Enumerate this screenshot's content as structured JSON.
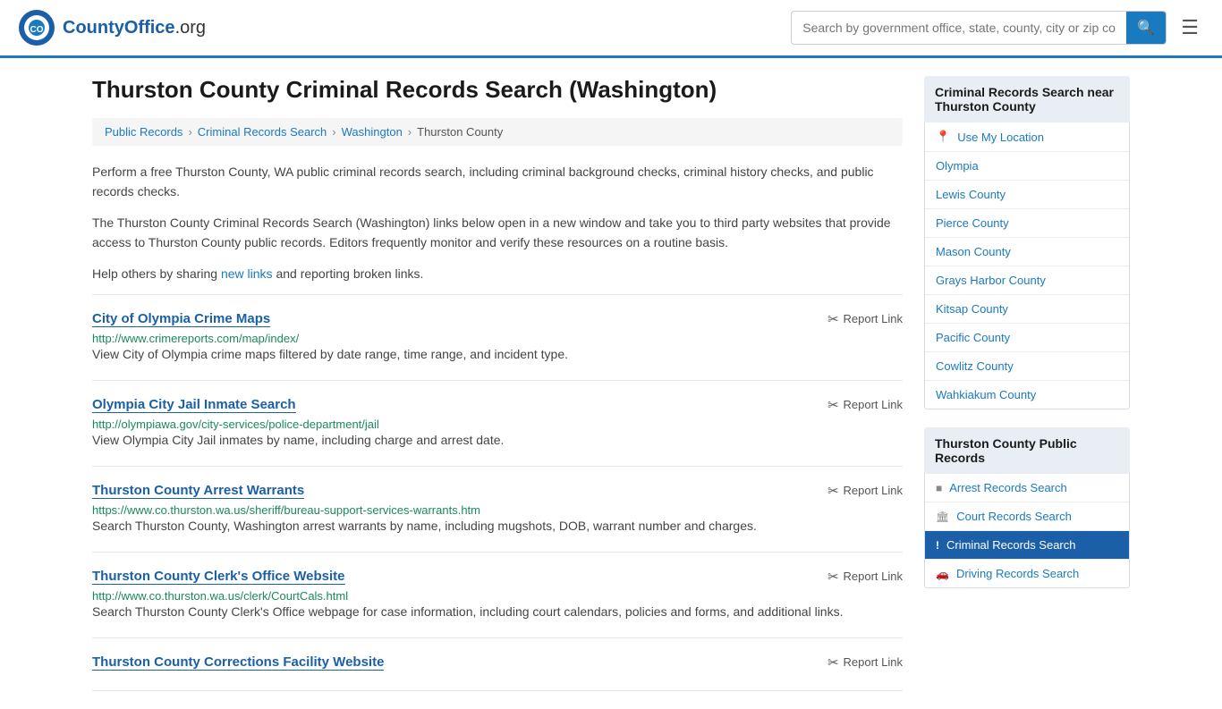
{
  "header": {
    "logo_text": "CountyOffice",
    "logo_suffix": ".org",
    "search_placeholder": "Search by government office, state, county, city or zip code"
  },
  "page": {
    "title": "Thurston County Criminal Records Search (Washington)",
    "breadcrumbs": [
      {
        "label": "Public Records",
        "href": "#"
      },
      {
        "label": "Criminal Records Search",
        "href": "#"
      },
      {
        "label": "Washington",
        "href": "#"
      },
      {
        "label": "Thurston County",
        "href": "#"
      }
    ],
    "intro1": "Perform a free Thurston County, WA public criminal records search, including criminal background checks, criminal history checks, and public records checks.",
    "intro2": "The Thurston County Criminal Records Search (Washington) links below open in a new window and take you to third party websites that provide access to Thurston County public records. Editors frequently monitor and verify these resources on a routine basis.",
    "intro3_prefix": "Help others by sharing ",
    "intro3_link": "new links",
    "intro3_suffix": " and reporting broken links."
  },
  "results": [
    {
      "title": "City of Olympia Crime Maps",
      "url": "http://www.crimereports.com/map/index/",
      "desc": "View City of Olympia crime maps filtered by date range, time range, and incident type.",
      "report": "Report Link"
    },
    {
      "title": "Olympia City Jail Inmate Search",
      "url": "http://olympiawa.gov/city-services/police-department/jail",
      "desc": "View Olympia City Jail inmates by name, including charge and arrest date.",
      "report": "Report Link"
    },
    {
      "title": "Thurston County Arrest Warrants",
      "url": "https://www.co.thurston.wa.us/sheriff/bureau-support-services-warrants.htm",
      "desc": "Search Thurston County, Washington arrest warrants by name, including mugshots, DOB, warrant number and charges.",
      "report": "Report Link"
    },
    {
      "title": "Thurston County Clerk's Office Website",
      "url": "http://www.co.thurston.wa.us/clerk/CourtCals.html",
      "desc": "Search Thurston County Clerk's Office webpage for case information, including court calendars, policies and forms, and additional links.",
      "report": "Report Link"
    },
    {
      "title": "Thurston County Corrections Facility Website",
      "url": "",
      "desc": "",
      "report": "Report Link"
    }
  ],
  "sidebar": {
    "nearby_header": "Criminal Records Search near Thurston County",
    "use_my_location": "Use My Location",
    "nearby_links": [
      {
        "label": "Olympia"
      },
      {
        "label": "Lewis County"
      },
      {
        "label": "Pierce County"
      },
      {
        "label": "Mason County"
      },
      {
        "label": "Grays Harbor County"
      },
      {
        "label": "Kitsap County"
      },
      {
        "label": "Pacific County"
      },
      {
        "label": "Cowlitz County"
      },
      {
        "label": "Wahkiakum County"
      }
    ],
    "public_records_header": "Thurston County Public Records",
    "public_records_links": [
      {
        "label": "Arrest Records Search",
        "icon": "■",
        "active": false
      },
      {
        "label": "Court Records Search",
        "icon": "🏛",
        "active": false
      },
      {
        "label": "Criminal Records Search",
        "icon": "!",
        "active": true
      },
      {
        "label": "Driving Records Search",
        "icon": "🚗",
        "active": false
      }
    ]
  }
}
